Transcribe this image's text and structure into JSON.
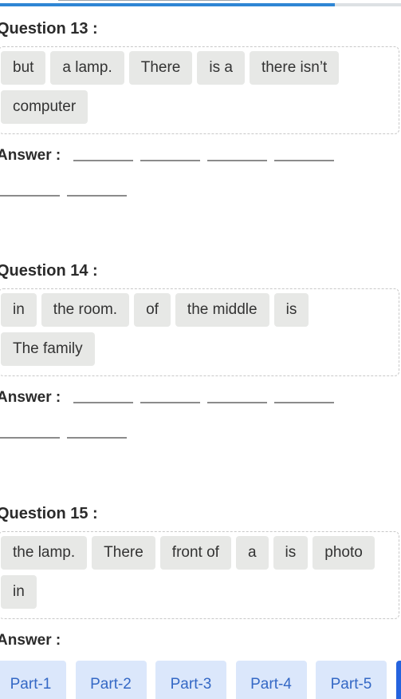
{
  "progress": {
    "percent": 83.5,
    "color": "#2f86d4"
  },
  "questions": [
    {
      "title": "Question 13 :",
      "words": [
        "but",
        "a lamp.",
        "There",
        "is a",
        "there isn’t",
        "computer"
      ],
      "answer_label": "Answer :",
      "blank_count": 6
    },
    {
      "title": "Question 14 :",
      "words": [
        "in",
        "the room.",
        "of",
        "the middle",
        "is",
        "The family"
      ],
      "answer_label": "Answer :",
      "blank_count": 6
    },
    {
      "title": "Question 15 :",
      "words": [
        "the lamp.",
        "There",
        "front of",
        "a",
        "is",
        "photo",
        "in"
      ],
      "answer_label": "Answer :",
      "blank_count": 0
    }
  ],
  "parts": {
    "items": [
      "Part-1",
      "Part-2",
      "Part-3",
      "Part-4",
      "Part-5",
      ""
    ],
    "active_index": 5,
    "colors": {
      "inactive_bg": "#dbe7fb",
      "inactive_text": "#3468c5",
      "active_bg": "#2563de"
    }
  }
}
